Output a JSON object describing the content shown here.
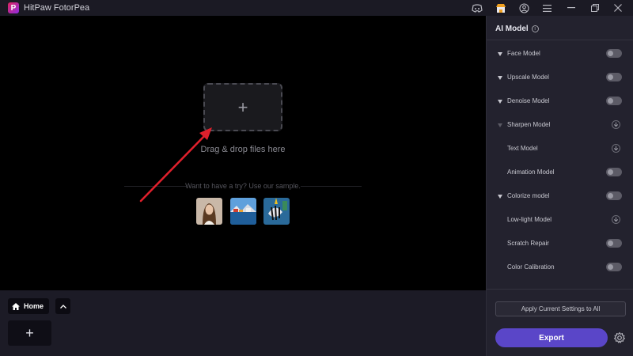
{
  "window": {
    "app_title": "HitPaw FotorPea",
    "logo_letter": "P",
    "icons": [
      "discord-icon",
      "shop-icon",
      "account-icon",
      "menu-icon",
      "minimize-icon",
      "restore-icon",
      "close-icon"
    ]
  },
  "canvas": {
    "drop_text": "Drag & drop files here",
    "drop_plus": "+",
    "sample_text": "Want to have a try? Use our sample.",
    "samples": [
      "sample-portrait",
      "sample-harbor",
      "sample-fish"
    ]
  },
  "bottom": {
    "home_label": "Home",
    "add_label": "+"
  },
  "panel": {
    "title": "AI Model",
    "info_glyph": "i",
    "models": [
      {
        "name": "Face Model",
        "control": "toggle",
        "caret": true
      },
      {
        "name": "Upscale Model",
        "control": "toggle",
        "caret": true
      },
      {
        "name": "Denoise Model",
        "control": "toggle",
        "caret": true
      },
      {
        "name": "Sharpen Model",
        "control": "download",
        "caret": true
      },
      {
        "name": "Text Model",
        "control": "download",
        "caret": false
      },
      {
        "name": "Animation Model",
        "control": "toggle",
        "caret": false
      },
      {
        "name": "Colorize model",
        "control": "toggle",
        "caret": true
      },
      {
        "name": "Low-light Model",
        "control": "download",
        "caret": false
      },
      {
        "name": "Scratch Repair",
        "control": "toggle",
        "caret": false
      },
      {
        "name": "Color Calibration",
        "control": "toggle",
        "caret": false
      }
    ],
    "apply_label": "Apply Current Settings to All",
    "export_label": "Export"
  },
  "colors": {
    "accent": "#5a46c8",
    "arrow": "#e0202c"
  }
}
